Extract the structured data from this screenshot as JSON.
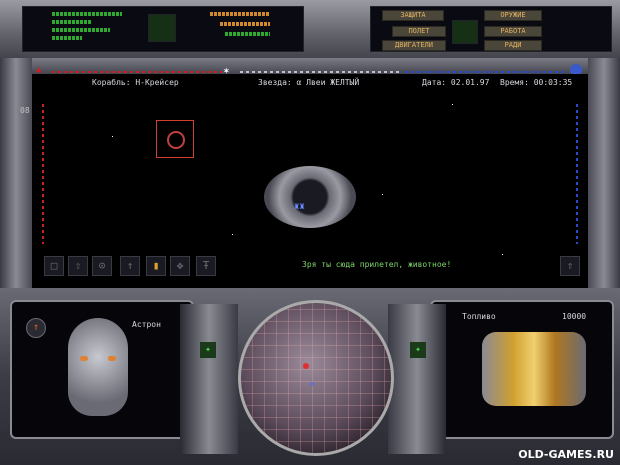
{
  "hud": {
    "ship": "Корабль: Н-Крейсер",
    "star": "Звезда: α Лвеи ЖЕЛТЫЙ",
    "date": "Дата: 02.01.97",
    "time": "Время: 00:03:35",
    "scale_value": "08",
    "message": "Зря ты сюда прилетел, животное!"
  },
  "left_pod": {
    "pilot_name": "Астрон"
  },
  "right_pod": {
    "fuel_label": "Топливо",
    "fuel_value": "10000"
  },
  "watermark": "OLD-GAMES.RU",
  "colors": {
    "hud_text": "#d8d8e0",
    "message": "#7fd36b",
    "red_arrow": "#cc2020",
    "blue_arrow": "#2a4acc"
  },
  "toolbar_icons": [
    "stop-icon",
    "arrow-up-icon",
    "target-icon",
    "up-icon",
    "fire-icon",
    "move-icon",
    "tool-icon"
  ],
  "top_labels": [
    "ЗАЩИТА",
    "ОРУЖИЕ",
    "ПОЛЕТ",
    "РАБОТА",
    "ДВИГАТЕЛИ",
    "РАДИ"
  ]
}
